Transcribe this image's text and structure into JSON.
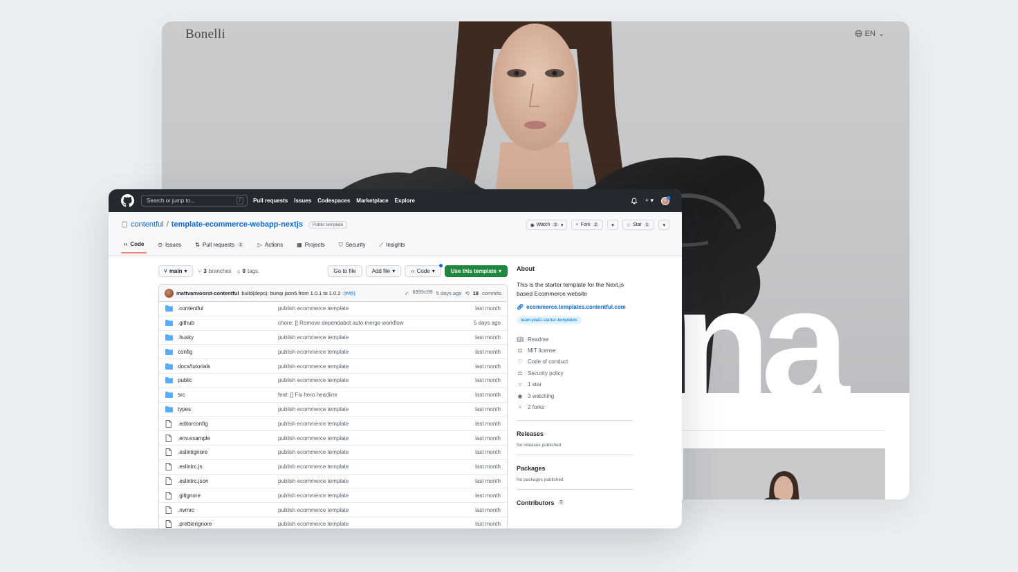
{
  "shop": {
    "brand": "Bonelli",
    "language": "EN",
    "hero_word": "na"
  },
  "github": {
    "search_placeholder": "Search or jump to...",
    "search_shortcut": "/",
    "nav": [
      "Pull requests",
      "Issues",
      "Codespaces",
      "Marketplace",
      "Explore"
    ],
    "repo_owner": "contentful",
    "repo_separator": "/",
    "repo_name": "template-ecommerce-webapp-nextjs",
    "visibility_badge": "Public template",
    "watch": {
      "label": "Watch",
      "count": "3"
    },
    "fork": {
      "label": "Fork",
      "count": "2"
    },
    "star": {
      "label": "Star",
      "count": "1"
    },
    "tabs": [
      {
        "label": "Code",
        "icon": "code-icon"
      },
      {
        "label": "Issues",
        "icon": "issue-icon"
      },
      {
        "label": "Pull requests",
        "icon": "pull-request-icon",
        "count": "1"
      },
      {
        "label": "Actions",
        "icon": "play-icon"
      },
      {
        "label": "Projects",
        "icon": "table-icon"
      },
      {
        "label": "Security",
        "icon": "shield-icon"
      },
      {
        "label": "Insights",
        "icon": "graph-icon"
      }
    ],
    "branch": "main",
    "branches_count": "3",
    "branches_label": "branches",
    "tags_count": "0",
    "tags_label": "tags",
    "go_to_file": "Go to file",
    "add_file": "Add file",
    "code_button": "Code",
    "use_template": "Use this template",
    "commit": {
      "author": "mattvanvoorst-contentful",
      "message": "build(deps): bump json5 from 1.0.1 to 1.0.2",
      "pr": "(#45)",
      "hash": "6995c99",
      "age": "5 days ago",
      "commits_count": "18",
      "commits_label": "commits"
    },
    "files": [
      {
        "type": "dir",
        "name": ".contentful",
        "message": "publish ecommerce template",
        "age": "last month"
      },
      {
        "type": "dir",
        "name": ".github",
        "message": "chore: [] Remove dependabot auto merge workflow",
        "age": "5 days ago"
      },
      {
        "type": "dir",
        "name": ".husky",
        "message": "publish ecommerce template",
        "age": "last month"
      },
      {
        "type": "dir",
        "name": "config",
        "message": "publish ecommerce template",
        "age": "last month"
      },
      {
        "type": "dir",
        "name": "docs/tutorials",
        "message": "publish ecommerce template",
        "age": "last month"
      },
      {
        "type": "dir",
        "name": "public",
        "message": "publish ecommerce template",
        "age": "last month"
      },
      {
        "type": "dir",
        "name": "src",
        "message": "feat: [] Fix hero headline",
        "age": "last month"
      },
      {
        "type": "dir",
        "name": "types",
        "message": "publish ecommerce template",
        "age": "last month"
      },
      {
        "type": "file",
        "name": ".editorconfig",
        "message": "publish ecommerce template",
        "age": "last month"
      },
      {
        "type": "file",
        "name": ".env.example",
        "message": "publish ecommerce template",
        "age": "last month"
      },
      {
        "type": "file",
        "name": ".eslintignore",
        "message": "publish ecommerce template",
        "age": "last month"
      },
      {
        "type": "file",
        "name": ".eslintrc.js",
        "message": "publish ecommerce template",
        "age": "last month"
      },
      {
        "type": "file",
        "name": ".eslintrc.json",
        "message": "publish ecommerce template",
        "age": "last month"
      },
      {
        "type": "file",
        "name": ".gitignore",
        "message": "publish ecommerce template",
        "age": "last month"
      },
      {
        "type": "file",
        "name": ".nvmrc",
        "message": "publish ecommerce template",
        "age": "last month"
      },
      {
        "type": "file",
        "name": ".prettierignore",
        "message": "publish ecommerce template",
        "age": "last month"
      }
    ],
    "about": {
      "heading": "About",
      "description": "This is the starter template for the Next.js based Ecommerce website",
      "website": "ecommerce.templates.contentful.com",
      "topic": "team-plato-starter-templates",
      "items": [
        {
          "icon": "book-icon",
          "label": "Readme"
        },
        {
          "icon": "law-icon",
          "label": "MIT license"
        },
        {
          "icon": "heart-icon",
          "label": "Code of conduct"
        },
        {
          "icon": "law-icon",
          "label": "Security policy"
        },
        {
          "icon": "star-icon",
          "label": "1 star"
        },
        {
          "icon": "eye-icon",
          "label": "3 watching"
        },
        {
          "icon": "fork-icon",
          "label": "2 forks"
        }
      ]
    },
    "releases": {
      "heading": "Releases",
      "text": "No releases published"
    },
    "packages": {
      "heading": "Packages",
      "text": "No packages published"
    },
    "contributors": {
      "heading": "Contributors",
      "count": "7"
    }
  },
  "colors": {
    "header_bg": "#24292f",
    "link_blue": "#0969da",
    "primary_green": "#1f883d",
    "folder_blue": "#54aeff",
    "tab_underline": "#fd8c73"
  }
}
